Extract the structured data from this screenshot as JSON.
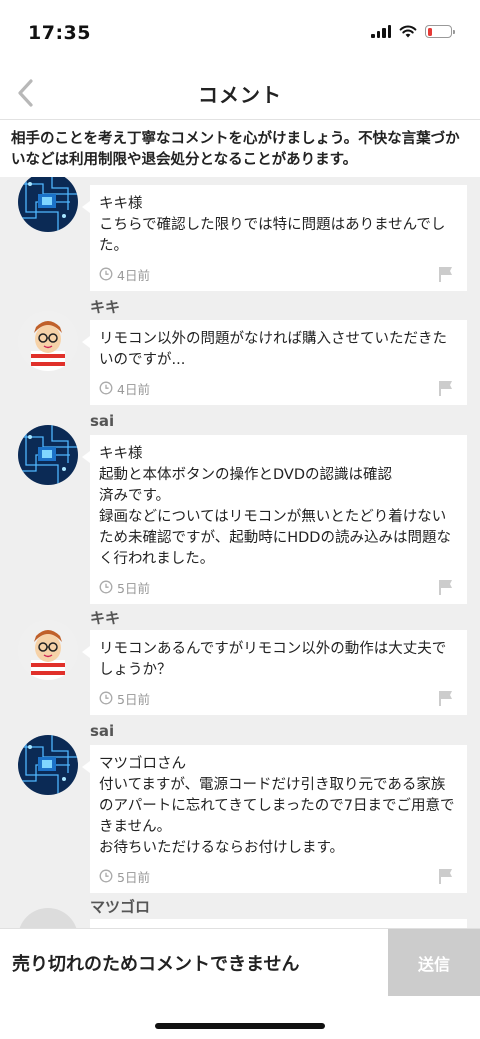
{
  "status_bar": {
    "time": "17:35"
  },
  "header": {
    "title": "コメント"
  },
  "notice": "相手のことを考え丁寧なコメントを心がけましょう。不快な言葉づかいなどは利用制限や退会処分となることがあります。",
  "comments": [
    {
      "author": "",
      "avatar": "circuit",
      "text": "キキ様\nこちらで確認した限りでは特に問題はありませんでした。",
      "time": "4日前"
    },
    {
      "author": "キキ",
      "avatar": "character",
      "text": "リモコン以外の問題がなければ購入させていただきたいのですが...",
      "time": "4日前"
    },
    {
      "author": "sai",
      "avatar": "circuit",
      "text": "キキ様\n起動と本体ボタンの操作とDVDの認識は確認\n済みです。\n録画などについてはリモコンが無いとたどり着けないため未確認ですが、起動時にHDDの読み込みは問題なく行われました。",
      "time": "5日前"
    },
    {
      "author": "キキ",
      "avatar": "character",
      "text": "リモコンあるんですがリモコン以外の動作は大丈夫でしょうか？",
      "time": "5日前"
    },
    {
      "author": "sai",
      "avatar": "circuit",
      "text": "マツゴロさん\n付いてますが、電源コードだけ引き取り元である家族のアパートに忘れてきてしまったので7日までご用意できません。\nお待ちいただけるならお付けします。",
      "time": "5日前"
    },
    {
      "author": "マツゴロ",
      "avatar": "placeholder",
      "text": "",
      "time": ""
    }
  ],
  "footer": {
    "message": "売り切れのためコメントできません",
    "send_label": "送信"
  },
  "colors": {
    "background": "#efefef",
    "bubble": "#ffffff",
    "send_disabled": "#cccccc",
    "battery_low": "#e53935"
  },
  "icons": [
    "back-chevron-icon",
    "clock-icon",
    "flag-icon",
    "signal-icon",
    "wifi-icon",
    "battery-icon"
  ]
}
